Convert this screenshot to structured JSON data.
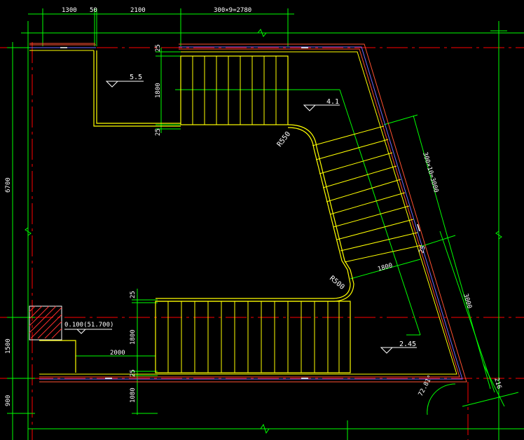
{
  "colors": {
    "background": "#000000",
    "dimension": "#00ff00",
    "wall": "#ffff00",
    "axis": "#ff0000",
    "wall_outer": "#ff6040",
    "wall_inner": "#4040ff",
    "text": "#ffffff",
    "grid_white": "#ffffff",
    "hatch": "#ff2020"
  },
  "dimensions": {
    "top": {
      "d1300": "1300",
      "d50": "50",
      "d2100": "2100",
      "d2780": "300×9=2780"
    },
    "left": {
      "d6700": "6700",
      "d1500": "1500",
      "d900": "900"
    },
    "upper_flight": {
      "top_25": "25",
      "width_1800": "1800",
      "bottom_25": "25"
    },
    "lower_flight": {
      "top_25": "25",
      "width_1800": "1800",
      "bottom_25": "25",
      "width_1080": "1080",
      "landing_2000": "2000"
    },
    "ramp": {
      "steps": "300×10=3000",
      "width_1800": "1800",
      "side_25": "25",
      "length_3000": "3000",
      "d216": "216"
    },
    "radius_upper": "R550",
    "radius_lower": "R500",
    "angle": "72.81°"
  },
  "levels": {
    "upper_landing": "5.5",
    "mid_landing": "4.1",
    "lower_landing": "2.45",
    "base": "0.100(51.700)"
  }
}
